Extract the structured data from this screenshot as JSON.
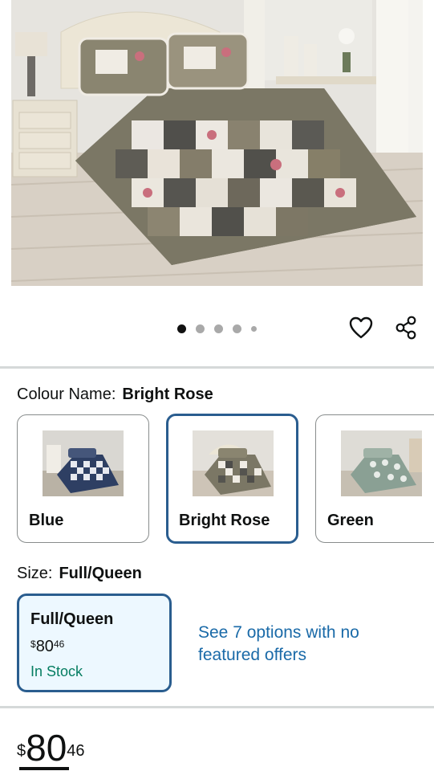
{
  "gallery": {
    "image_alt": "Patchwork quilt bedspread set on a bed",
    "dots_count": 5,
    "active_dot": 0
  },
  "actions": {
    "wishlist_icon": "heart-icon",
    "share_icon": "share-icon"
  },
  "colour": {
    "label": "Colour Name:",
    "selected": "Bright Rose",
    "options": [
      {
        "name": "Blue"
      },
      {
        "name": "Bright Rose"
      },
      {
        "name": "Green"
      }
    ]
  },
  "size": {
    "label": "Size:",
    "selected": "Full/Queen",
    "card": {
      "title": "Full/Queen",
      "price_currency": "$",
      "price_whole": "80",
      "price_fraction": "46",
      "stock": "In Stock"
    },
    "see_options": "See 7 options with no featured offers"
  },
  "price": {
    "currency": "$",
    "whole": "80",
    "fraction": "46"
  },
  "colors": {
    "accent": "#2a5d8f",
    "link": "#1a6aa8",
    "stock": "#067d62",
    "selected_bg": "#edf8ff"
  }
}
